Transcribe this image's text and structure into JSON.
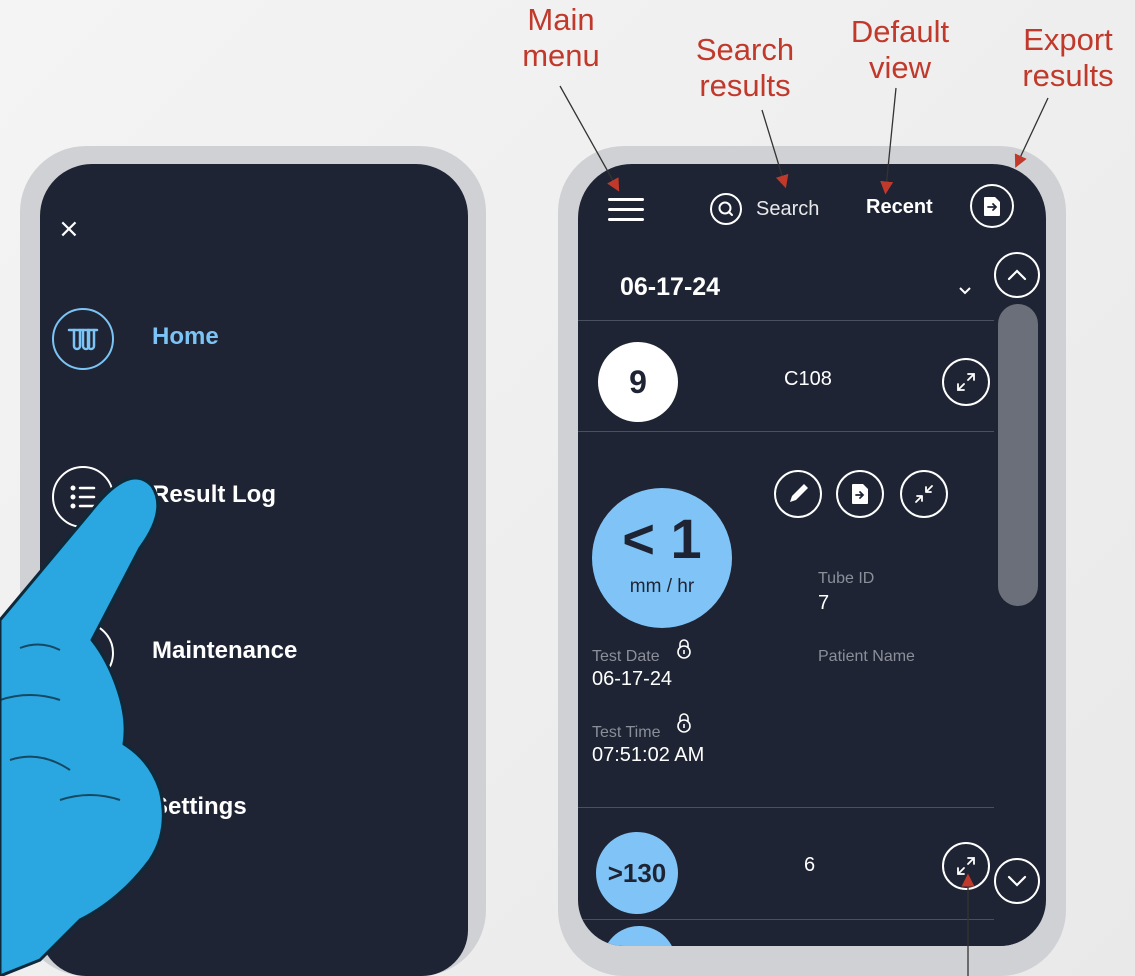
{
  "callouts": {
    "main_menu": "Main\nmenu",
    "search_results": "Search\nresults",
    "default_view": "Default\nview",
    "export_results": "Export\nresults"
  },
  "left_menu": {
    "close_icon": "×",
    "items": [
      {
        "label": "Home",
        "icon": "test-tubes-icon",
        "active": true
      },
      {
        "label": "Result Log",
        "icon": "list-icon",
        "active": false
      },
      {
        "label": "Maintenance",
        "icon": "maintenance-icon",
        "active": false
      },
      {
        "label": "Settings",
        "icon": "gear-icon",
        "active": false
      }
    ]
  },
  "right_screen": {
    "search_label": "Search",
    "recent_label": "Recent",
    "date": "06-17-24",
    "rows": [
      {
        "value": "9",
        "id": "C108"
      },
      {
        "value": "< 1",
        "unit": "mm / hr",
        "tube_id_label": "Tube ID",
        "tube_id": "7",
        "patient_name_label": "Patient Name",
        "test_date_label": "Test Date",
        "test_date": "06-17-24",
        "test_time_label": "Test Time",
        "test_time": "07:51:02 AM"
      },
      {
        "value": ">130",
        "id": "6"
      }
    ]
  },
  "colors": {
    "screen_bg": "#1e2433",
    "accent_blue": "#80c4f7",
    "callout_red": "#c0392b",
    "glove_blue": "#2aa6e0"
  }
}
